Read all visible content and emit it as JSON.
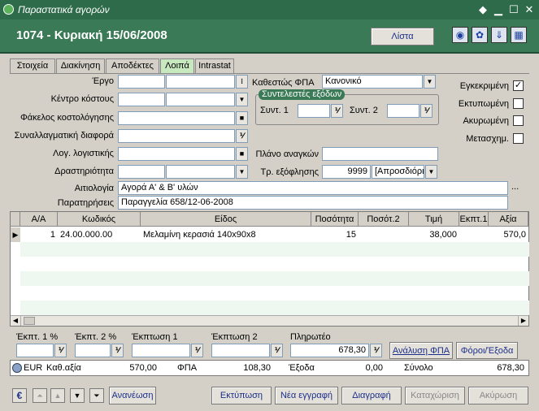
{
  "window": {
    "title": "Παραστατικά αγορών"
  },
  "header": {
    "record": "1074 - Κυριακή 15/06/2008",
    "list_button": "Λίστα"
  },
  "tabs": [
    "Στοιχεία",
    "Διακίνηση",
    "Αποδέκτες",
    "Λοιπά",
    "Intrastat"
  ],
  "form": {
    "ergo_label": "Έργο",
    "kentro_label": "Κέντρο κόστους",
    "fakelos_label": "Φάκελος κοστολόγησης",
    "synallag_label": "Συναλλαγματική διαφορά",
    "log_label": "Λογ. λογιστικής",
    "drast_label": "Δραστηριότητα",
    "fpa_label": "Καθεστώς ΦΠΑ",
    "fpa_value": "Κανονικό",
    "syntelestes_title": "Συντελεστές εξόδων",
    "synt1_label": "Συντ. 1",
    "synt2_label": "Συντ. 2",
    "plano_label": "Πλάνο αναγκών",
    "tr_label": "Τρ. εξόφλησης",
    "tr_code": "9999",
    "tr_value": "[Απροσδιόρι",
    "aitiologia_label": "Αιτιολογία",
    "aitiologia_value": "Αγορά Α' & Β' υλών",
    "paratiriseis_label": "Παρατηρήσεις",
    "paratiriseis_value": "Παραγγελία 658/12-06-2008",
    "ellipsis": "..."
  },
  "flags": {
    "egkekrimeni": "Εγκεκριμένη",
    "ektypomeni": "Εκτυπωμένη",
    "akyromeni": "Ακυρωμένη",
    "metasxim": "Μετασχημ."
  },
  "grid": {
    "columns": [
      "Α/Α",
      "Κωδικός",
      "Είδος",
      "Ποσότητα",
      "Ποσότ.2",
      "Τιμή",
      "Εκπτ.1",
      "Αξία"
    ],
    "row": {
      "aa": "1",
      "code": "24.00.000.00",
      "item": "Μελαμίνη κερασιά 140x90x8",
      "qty": "15",
      "qty2": "",
      "price": "38,000",
      "disc": "",
      "value": "570,0"
    }
  },
  "footer": {
    "ekpt1_label": "Έκπτ. 1 %",
    "ekpt2_label": "Έκπτ. 2 %",
    "ekptosi1_label": "Έκπτωση 1",
    "ekptosi2_label": "Έκπτωση 2",
    "plirotea_label": "Πληρωτέο",
    "plirotea_value": "678,30",
    "analysis_btn": "Ανάλυση ΦΠΑ",
    "foroi_btn": "Φόροι/Έξοδα"
  },
  "status": {
    "currency": "EUR",
    "kath_label": "Καθ.αξία",
    "kath_value": "570,00",
    "fpa_label": "ΦΠΑ",
    "fpa_value": "108,30",
    "exoda_label": "Έξοδα",
    "exoda_value": "0,00",
    "total_label": "Σύνολο",
    "total_value": "678,30"
  },
  "toolbar": {
    "refresh": "Ανανέωση",
    "print": "Εκτύπωση",
    "new": "Νέα εγγραφή",
    "delete": "Διαγραφή",
    "save": "Καταχώριση",
    "cancel": "Ακύρωση"
  }
}
